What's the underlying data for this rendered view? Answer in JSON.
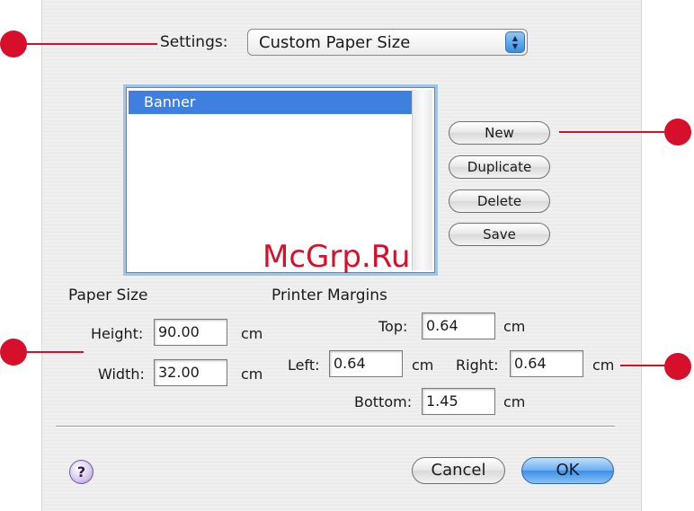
{
  "settings": {
    "label": "Settings:",
    "value": "Custom Paper Size",
    "arrows": "▲▼"
  },
  "paper_list": {
    "items": [
      "Banner"
    ],
    "selected": "Banner"
  },
  "side_buttons": {
    "new": "New",
    "duplicate": "Duplicate",
    "delete": "Delete",
    "save": "Save"
  },
  "paper_size": {
    "header": "Paper Size",
    "height_label": "Height:",
    "height_value": "90.00",
    "height_unit": "cm",
    "width_label": "Width:",
    "width_value": "32.00",
    "width_unit": "cm"
  },
  "margins": {
    "header": "Printer Margins",
    "top_label": "Top:",
    "top_value": "0.64",
    "top_unit": "cm",
    "left_label": "Left:",
    "left_value": "0.64",
    "left_unit": "cm",
    "right_label": "Right:",
    "right_value": "0.64",
    "right_unit": "cm",
    "bottom_label": "Bottom:",
    "bottom_value": "1.45",
    "bottom_unit": "cm"
  },
  "footer": {
    "help": "?",
    "cancel": "Cancel",
    "ok": "OK"
  },
  "watermark": "McGrp.Ru",
  "colors": {
    "callout": "#d6102a",
    "selection": "#3d80df",
    "default_button": "#3f8ee6"
  }
}
